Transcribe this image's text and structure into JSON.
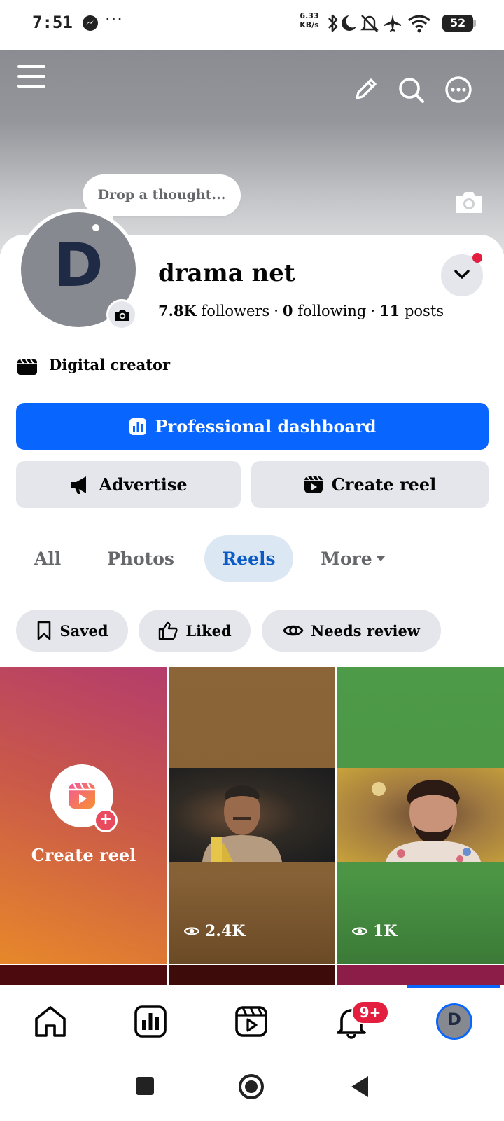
{
  "status_bar": {
    "time": "7:51",
    "more": "···",
    "net_speed_value": "6.33",
    "net_speed_unit": "KB/s",
    "battery": "52",
    "icons": [
      "messenger-icon",
      "bluetooth-icon",
      "moon-icon",
      "bell-off-icon",
      "airplane-icon",
      "wifi-icon",
      "battery-icon"
    ]
  },
  "cover": {
    "menu_icon": "menu-icon",
    "edit_icon": "pencil-icon",
    "search_icon": "search-icon",
    "more_icon": "more-icon",
    "camera_icon": "camera-icon"
  },
  "profile": {
    "thought_placeholder": "Drop a thought...",
    "avatar_letter": "D",
    "name": "drama net",
    "followers_count": "7.8K",
    "followers_label": "followers",
    "following_count": "0",
    "following_label": "following",
    "posts_count": "11",
    "posts_label": "posts",
    "separator": "·",
    "category": "Digital creator"
  },
  "actions": {
    "primary": "Professional dashboard",
    "advertise": "Advertise",
    "create_reel": "Create reel"
  },
  "tabs": [
    {
      "label": "All",
      "active": false
    },
    {
      "label": "Photos",
      "active": false
    },
    {
      "label": "Reels",
      "active": true
    },
    {
      "label": "More",
      "active": false
    }
  ],
  "filters": [
    {
      "label": "Saved",
      "icon": "bookmark-icon"
    },
    {
      "label": "Liked",
      "icon": "thumbs-up-icon"
    },
    {
      "label": "Needs review",
      "icon": "eye-icon"
    }
  ],
  "reels": {
    "create_label": "Create reel",
    "items": [
      {
        "views": "2.4K"
      },
      {
        "views": "1K"
      }
    ]
  },
  "bottom_nav": {
    "items": [
      "home-icon",
      "dashboard-icon",
      "reels-icon",
      "notifications-icon",
      "profile-avatar"
    ],
    "notification_badge": "9+",
    "avatar_letter": "D",
    "active": "profile-avatar"
  },
  "colors": {
    "brand_blue": "#0866ff",
    "active_tab_bg": "#dbe7f2",
    "active_tab_text": "#0a5bc5",
    "badge_red": "#e41e3f",
    "button_gray": "#e4e6eb"
  }
}
